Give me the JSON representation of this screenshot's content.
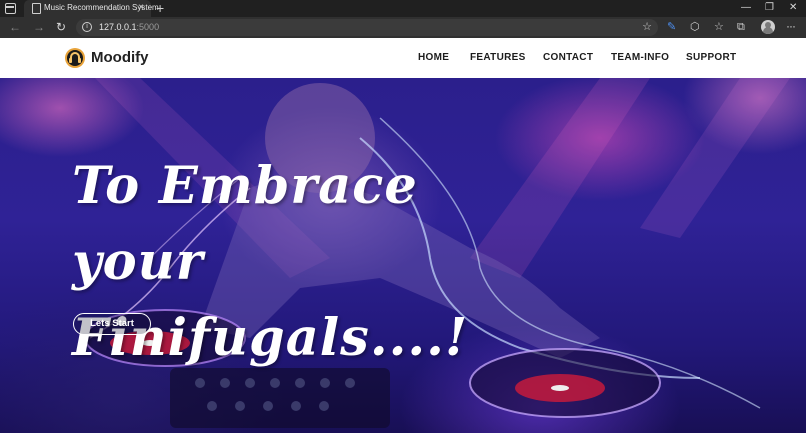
{
  "browser": {
    "tab_title": "Music Recommendation System",
    "tab_close": "×",
    "new_tab": "+",
    "url_host": "127.0.0.1",
    "url_port": ":5000",
    "icons": [
      "tab-actions-icon",
      "back-icon",
      "forward-icon",
      "refresh-icon",
      "info-icon",
      "star-add-icon",
      "extension-icon",
      "puzzle-icon",
      "favorites-icon",
      "collections-icon",
      "profile-icon",
      "more-icon"
    ],
    "window_controls": {
      "minimize": "—",
      "restore": "❐",
      "close": "✕"
    }
  },
  "site": {
    "brand": "Moodify",
    "nav": [
      "HOME",
      "FEATURES",
      "CONTACT",
      "TEAM-INFO",
      "SUPPORT"
    ]
  },
  "hero": {
    "title": "To Embrace your Finifugals....!",
    "cta_label": "Lets Start"
  },
  "colors": {
    "header_bg": "#ffffff",
    "hero_base": "#2f2296",
    "cta_border": "#ffffff",
    "logo_accent": "#e8a33a"
  }
}
